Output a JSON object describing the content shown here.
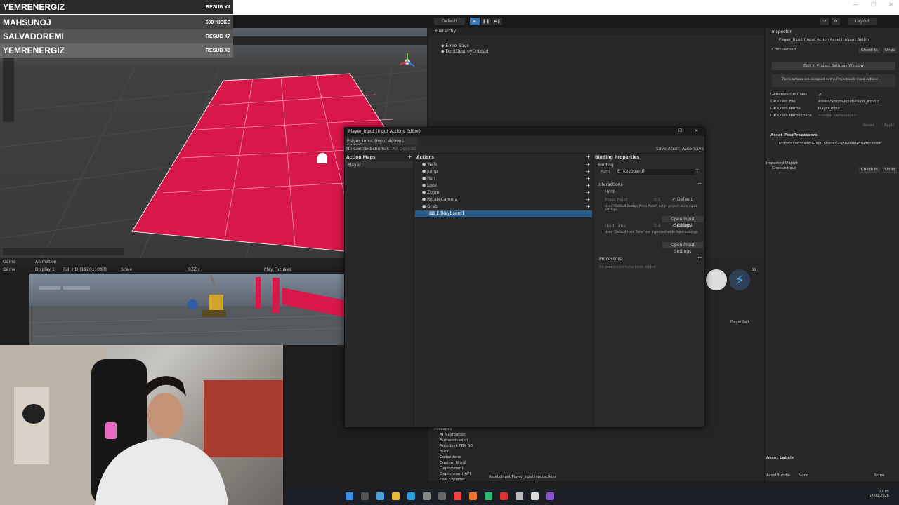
{
  "overlay": {
    "rows": [
      {
        "name": "YEMRENERGIZ",
        "value": "RESUB X4"
      },
      {
        "name": "MAHSUNOJ",
        "value": "500 KICKS"
      },
      {
        "name": "SALVADOREMI",
        "value": "RESUB X7"
      },
      {
        "name": "YEMRENERGIZ",
        "value": "RESUB X3"
      }
    ]
  },
  "toolbar": {
    "layout_label": "Layout",
    "default_label": "Default"
  },
  "hierarchy": {
    "tab": "Hierarchy",
    "items": [
      "Emre_Save",
      "DontDestroyOnLoad"
    ]
  },
  "game": {
    "tab_game": "Game",
    "tab_animation": "Animation",
    "display": "Display 1",
    "resolution": "Full HD (1920x1080)",
    "scale_label": "Scale",
    "scale_value": "0.55x",
    "play_focused": "Play Focused"
  },
  "editor": {
    "title": "Player_Input (Input Actions Editor)",
    "tab": "Player_Input (Input Actions Editor)",
    "control_schemes": "No Control Schemes",
    "all_devices": "All Devices",
    "save_asset": "Save Asset",
    "auto_save": "Auto-Save",
    "action_maps_header": "Action Maps",
    "action_map": "Player",
    "actions_header": "Actions",
    "actions": [
      "Walk",
      "Jump",
      "Run",
      "Look",
      "Zoom",
      "RotateCamera",
      "Grab"
    ],
    "selected_binding": "E [Keyboard]",
    "binding_props_header": "Binding Properties",
    "binding_label": "Binding",
    "path_label": "Path",
    "path_value": "E [Keyboard]",
    "interactions_label": "Interactions",
    "hold_label": "Hold",
    "press_point_label": "Press Point",
    "press_point_value": "0.5",
    "default_label": "Default",
    "press_point_note": "Uses \"Default Button Press Point\" set in project-wide input settings.",
    "open_input_settings": "Open Input Settings",
    "hold_time_label": "Hold Time",
    "hold_time_value": "0.4",
    "hold_time_note": "Uses \"Default Hold Time\" set in project-wide input settings.",
    "processors_label": "Processors",
    "no_processors": "No processors have been added."
  },
  "inspector": {
    "tab": "Inspector",
    "asset_title": "Player_Input (Input Action Asset) Import Settin",
    "checked_out": "Checked out",
    "check_in": "Check In",
    "undo": "Undo",
    "edit_project_settings": "Edit in Project Settings Window",
    "project_wide_note": "These actions are assigned as the Project-wide Input Actions.",
    "generate_class": "Generate C# Class",
    "class_file_label": "C# Class File",
    "class_file_value": "Assets/Scripts/Input/Player_Input.c",
    "class_name_label": "C# Class Name",
    "class_name_value": "Player_Input",
    "namespace_label": "C# Class Namespace",
    "namespace_placeholder": "<Global namespace>",
    "revert": "Revert",
    "apply": "Apply",
    "postprocessors": "Asset PostProcessors",
    "postprocessor_item": "UnityEditor.ShaderGraph.ShaderGraphAssetPostProcessor",
    "imported_object": "Imported Object",
    "asset_labels": "Asset Labels",
    "asset_bundle": "AssetBundle",
    "bundle_value": "None",
    "bundle_variant": "None"
  },
  "project": {
    "packages": [
      "Packages",
      "AI Navigation",
      "Authentication",
      "Autodesk FBX SD",
      "Burst",
      "Collections",
      "Custom NUnit",
      "Deployment",
      "Deployment API",
      "FBX Exporter"
    ],
    "path": "Assets/Input/Player_Input.inputactions",
    "asset_label": "PlayerWalk",
    "count": "35"
  },
  "clock": {
    "time": "22:05",
    "date": "17.03.2026"
  },
  "colors": {
    "plane": "#d8174a",
    "selection": "#2c5d87",
    "accent": "#4aa3df"
  }
}
